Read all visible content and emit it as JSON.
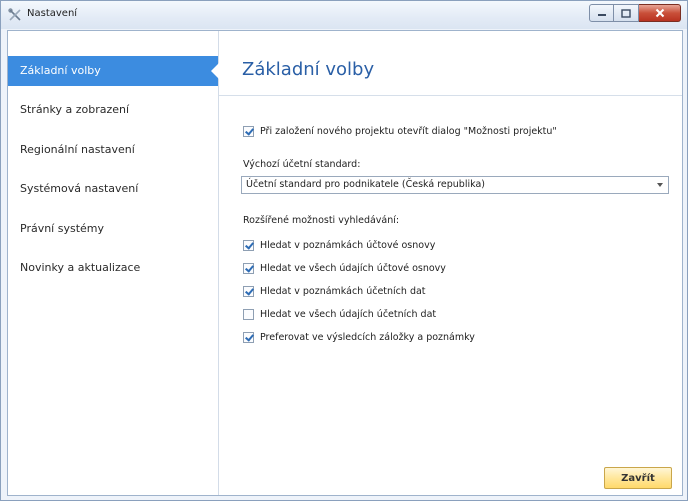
{
  "window": {
    "title": "Nastavení",
    "icon": "settings-tools-icon",
    "controls": [
      "minimize-icon",
      "maximize-icon",
      "close-icon"
    ]
  },
  "sidebar": {
    "items": [
      {
        "label": "Základní volby",
        "active": true
      },
      {
        "label": "Stránky a zobrazení",
        "active": false
      },
      {
        "label": "Regionální nastavení",
        "active": false
      },
      {
        "label": "Systémová nastavení",
        "active": false
      },
      {
        "label": "Právní systémy",
        "active": false
      },
      {
        "label": "Novinky a aktualizace",
        "active": false
      }
    ]
  },
  "main": {
    "title": "Základní volby",
    "open_dialog_checkbox": {
      "label": "Při založení nového projektu otevřít dialog \"Možnosti projektu\"",
      "checked": true
    },
    "standard": {
      "label": "Výchozí účetní standard:",
      "selected": "Účetní standard pro podnikatele (Česká republika)"
    },
    "search": {
      "label": "Rozšířené možnosti vyhledávání:",
      "options": [
        {
          "label": "Hledat v poznámkách účtové osnovy",
          "checked": true
        },
        {
          "label": "Hledat ve všech údajích účtové osnovy",
          "checked": true
        },
        {
          "label": "Hledat v poznámkách účetních dat",
          "checked": true
        },
        {
          "label": "Hledat ve všech údajích účetních dat",
          "checked": false
        },
        {
          "label": "Preferovat ve výsledcích záložky a poznámky",
          "checked": true
        }
      ]
    },
    "close_label": "Zavřít"
  },
  "colors": {
    "accent": "#3c8ce0",
    "title_text": "#2a5fa6",
    "close_button": "#ffe79c"
  }
}
